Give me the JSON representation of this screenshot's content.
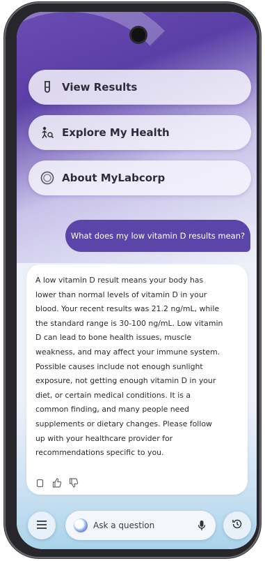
{
  "menu": [
    {
      "label": "View Results",
      "icon": "test-tube-icon"
    },
    {
      "label": "Explore My Health",
      "icon": "person-search-icon"
    },
    {
      "label": "About MyLabcorp",
      "icon": "swirl-logo-icon"
    }
  ],
  "chat": {
    "user_message": "What does my low vitamin D results mean?",
    "reply_lines": [
      "A low vitamin D result means your body has",
      "lower than normal levels of vitamin D in your",
      "blood. Your recent results was 21.2 ng/mL, while",
      "the standard range is 30-100 ng/mL. Low vitamin",
      "D can lead to bone health issues, muscle",
      "weakness, and may affect your immune system.",
      "Possible causes include not enough sunlight",
      "exposure, not getting enough vitamin D in your",
      "diet, or certain medical conditions. It is a",
      "common finding, and many people need",
      "supplements or dietary changes. Please follow",
      "up with your healthcare provider for",
      "recommendations specific to you."
    ]
  },
  "input": {
    "placeholder": "Ask a question"
  },
  "colors": {
    "accent": "#5b45a8",
    "bubble_text": "#ffffff"
  }
}
